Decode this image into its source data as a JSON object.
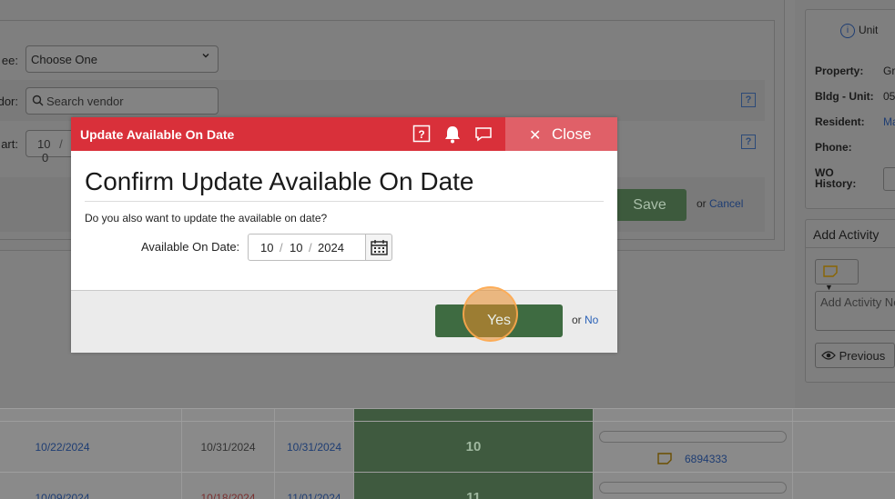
{
  "form": {
    "assignee_label": "ee:",
    "assignee_value": "Choose One",
    "vendor_label": "dor:",
    "vendor_placeholder": "Search vendor",
    "start_label": "art:",
    "start_month": "10",
    "start_sep": "/",
    "start_day_partial": "0",
    "help_glyph": "?",
    "save_label": "Save",
    "or_text": "or",
    "cancel_label": "Cancel"
  },
  "unit_panel": {
    "heading": "Unit",
    "info_glyph": "i",
    "fields": [
      {
        "label": "Property:",
        "value": "Gr"
      },
      {
        "label": "Bldg - Unit:",
        "value": "05"
      },
      {
        "label": "Resident:",
        "value": "Ma"
      },
      {
        "label": "Phone:",
        "value": ""
      },
      {
        "label": "WO",
        "value": ""
      },
      {
        "label": "History:",
        "value": ""
      }
    ]
  },
  "activity_panel": {
    "title": "Add Activity",
    "input_placeholder": "Add Activity No",
    "previous_label": "Previous"
  },
  "table": {
    "rows": [
      {
        "c1": "",
        "c2": "",
        "c3": "",
        "count": "",
        "note": ""
      },
      {
        "c1": "10/22/2024",
        "c2": "10/31/2024",
        "c3": "10/31/2024",
        "count": "10",
        "note": "6894333"
      },
      {
        "c1": "10/09/2024",
        "c2": "10/18/2024",
        "c3": "11/01/2024",
        "count": "11",
        "note": ""
      }
    ]
  },
  "modal": {
    "title": "Update Available On Date",
    "close_label": "Close",
    "close_glyph": "✕",
    "heading": "Confirm Update Available On Date",
    "question": "Do you also want to update the available on date?",
    "available_label": "Available On Date:",
    "date": {
      "month": "10",
      "day": "10",
      "year": "2024",
      "sep": "/"
    },
    "yes_label": "Yes",
    "or_text": "or",
    "no_label": "No"
  },
  "colors": {
    "header_red": "#d9303a",
    "close_red": "#e06068",
    "yes_green": "#3e6b41",
    "link_blue": "#2b62b8"
  }
}
